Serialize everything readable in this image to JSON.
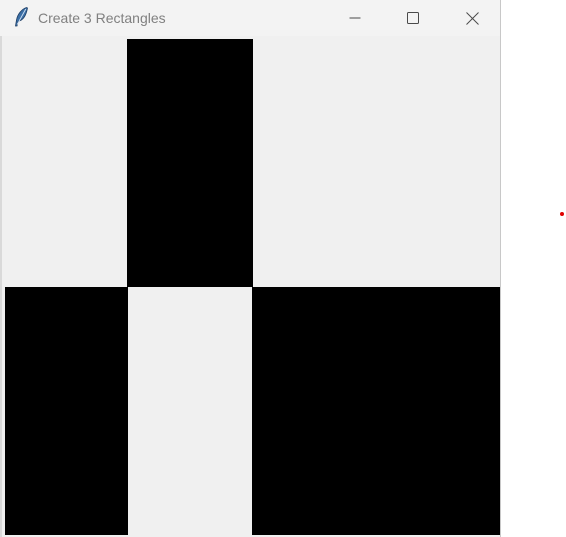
{
  "window": {
    "title": "Create 3 Rectangles",
    "icon": "feather-icon"
  },
  "titlebar_buttons": {
    "minimize": "minimize-icon",
    "maximize": "maximize-icon",
    "close": "close-icon"
  },
  "canvas": {
    "background_color": "#f0f0f0",
    "rectangles": [
      {
        "name": "rectangle-1",
        "color": "#000000"
      },
      {
        "name": "rectangle-2",
        "color": "#000000"
      },
      {
        "name": "rectangle-3",
        "color": "#000000"
      }
    ]
  },
  "cursor_marker": {
    "color": "#e00000"
  }
}
